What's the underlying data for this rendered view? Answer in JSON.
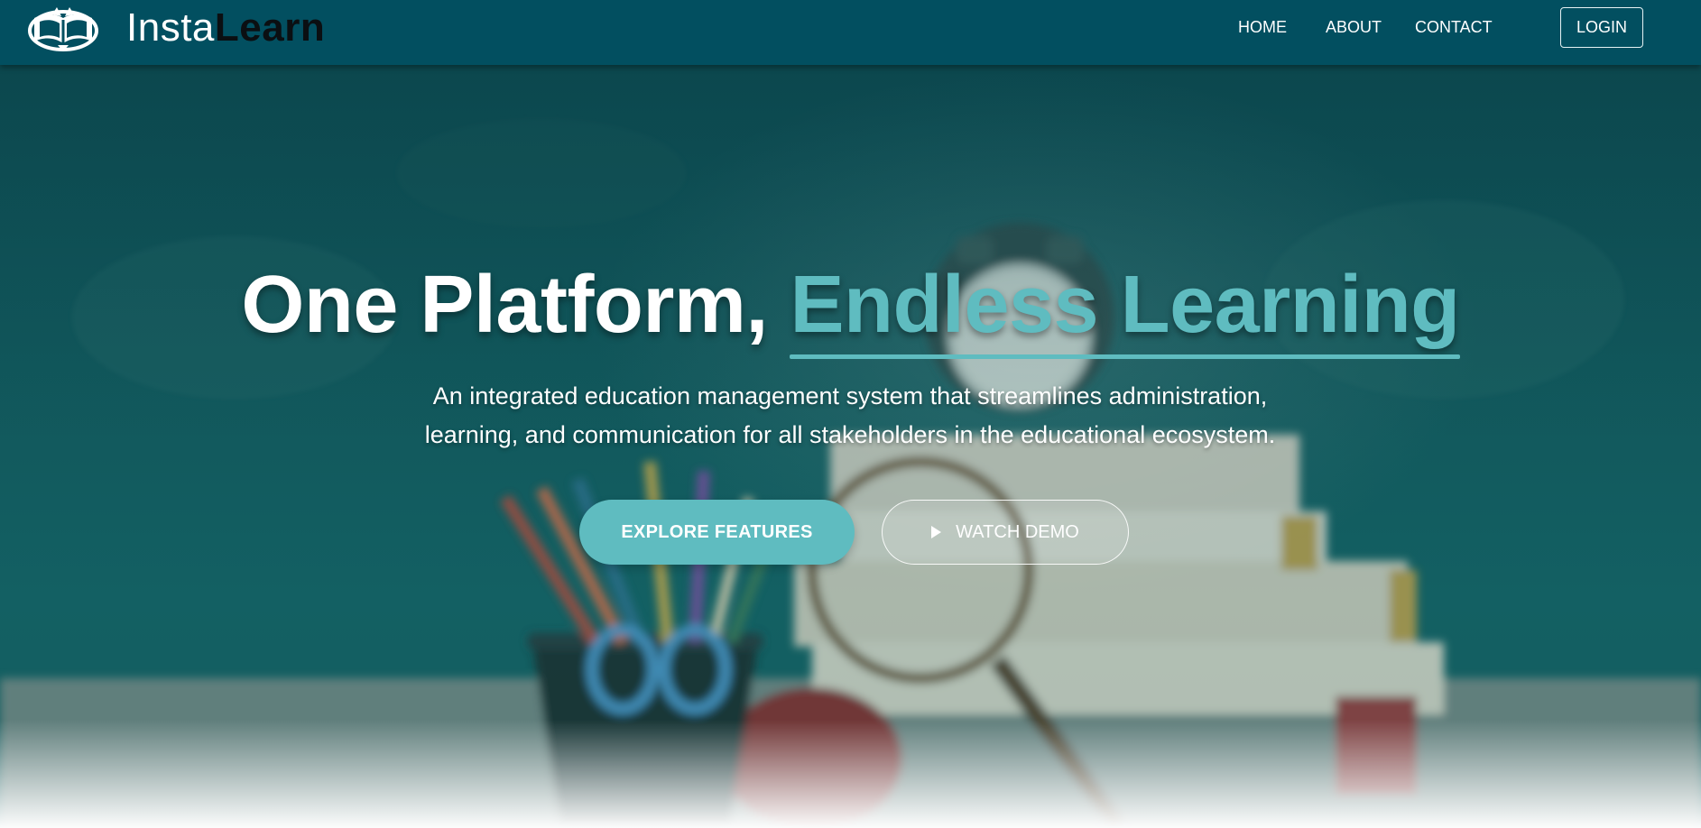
{
  "brand": {
    "part1": "Insta",
    "part2": "Learn",
    "logo_icon": "open-book-logo-icon"
  },
  "nav": {
    "items": [
      {
        "label": "HOME"
      },
      {
        "label": "ABOUT"
      },
      {
        "label": "CONTACT"
      }
    ],
    "login_label": "LOGIN"
  },
  "hero": {
    "headline_plain": "One Platform, ",
    "headline_accent": "Endless Learning",
    "subtitle_line1": "An integrated education management system that streamlines administration,",
    "subtitle_line2": "learning, and communication for all stakeholders in the educational ecosystem.",
    "primary_button": "EXPLORE FEATURES",
    "secondary_button": "WATCH DEMO",
    "secondary_icon": "play-icon"
  },
  "colors": {
    "navbar": "#024f60",
    "accent": "#5fbcc0",
    "brand_dark": "#0b0f12",
    "hero_bg": "#11575b"
  }
}
